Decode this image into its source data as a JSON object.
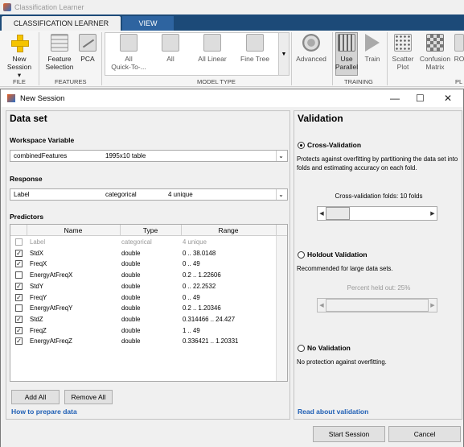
{
  "app": {
    "title": "Classification Learner"
  },
  "tabs": [
    {
      "label": "CLASSIFICATION LEARNER"
    },
    {
      "label": "VIEW"
    }
  ],
  "ribbon": {
    "new_session": [
      "New",
      "Session ▾"
    ],
    "feature_selection": [
      "Feature",
      "Selection"
    ],
    "pca": "PCA",
    "gallery": [
      {
        "line1": "All",
        "line2": "Quick-To-..."
      },
      {
        "line1": "All",
        "line2": ""
      },
      {
        "line1": "All Linear",
        "line2": ""
      },
      {
        "line1": "Fine Tree",
        "line2": ""
      }
    ],
    "advanced": "Advanced",
    "use_parallel": [
      "Use",
      "Parallel"
    ],
    "train": "Train",
    "scatter_plot": [
      "Scatter",
      "Plot"
    ],
    "confusion_matrix": [
      "Confusion",
      "Matrix"
    ],
    "roc": "RO",
    "groups": [
      "FILE",
      "FEATURES",
      "MODEL TYPE",
      "TRAINING",
      "PL"
    ]
  },
  "dialog": {
    "title": "New Session",
    "controls": {
      "min": "—",
      "max": "☐",
      "close": "✕"
    },
    "dataset": {
      "title": "Data set",
      "workspace_label": "Workspace Variable",
      "workspace_value": "combinedFeatures",
      "workspace_size": "1995x10 table",
      "response_label": "Response",
      "response_value": "Label",
      "response_type": "categorical",
      "response_unique": "4 unique",
      "predictors_label": "Predictors",
      "columns": [
        "Name",
        "Type",
        "Range"
      ],
      "rows": [
        {
          "checked": "",
          "name": "Label",
          "type": "categorical",
          "range": "4 unique"
        },
        {
          "checked": "✓",
          "name": "StdX",
          "type": "double",
          "range": "0 .. 38.0148"
        },
        {
          "checked": "✓",
          "name": "FreqX",
          "type": "double",
          "range": "0 .. 49"
        },
        {
          "checked": "",
          "name": "EnergyAtFreqX",
          "type": "double",
          "range": "0.2 .. 1.22606"
        },
        {
          "checked": "✓",
          "name": "StdY",
          "type": "double",
          "range": "0 .. 22.2532"
        },
        {
          "checked": "✓",
          "name": "FreqY",
          "type": "double",
          "range": "0 .. 49"
        },
        {
          "checked": "",
          "name": "EnergyAtFreqY",
          "type": "double",
          "range": "0.2 .. 1.20346"
        },
        {
          "checked": "✓",
          "name": "StdZ",
          "type": "double",
          "range": "0.314466 .. 24.427"
        },
        {
          "checked": "✓",
          "name": "FreqZ",
          "type": "double",
          "range": "1 .. 49"
        },
        {
          "checked": "✓",
          "name": "EnergyAtFreqZ",
          "type": "double",
          "range": "0.336421 .. 1.20331"
        }
      ],
      "add_all": "Add All",
      "remove_all": "Remove All",
      "help_link": "How to prepare data"
    },
    "validation": {
      "title": "Validation",
      "cross_label": "Cross-Validation",
      "cross_desc": "Protects against overfitting by partitioning the data set into folds and estimating accuracy on each fold.",
      "folds_text": "Cross-validation folds: 10 folds",
      "holdout_label": "Holdout Validation",
      "holdout_desc": "Recommended for large data sets.",
      "holdout_text": "Percent held out: 25%",
      "none_label": "No Validation",
      "none_desc": "No protection against overfitting.",
      "help_link": "Read about validation"
    },
    "start": "Start Session",
    "cancel": "Cancel"
  }
}
